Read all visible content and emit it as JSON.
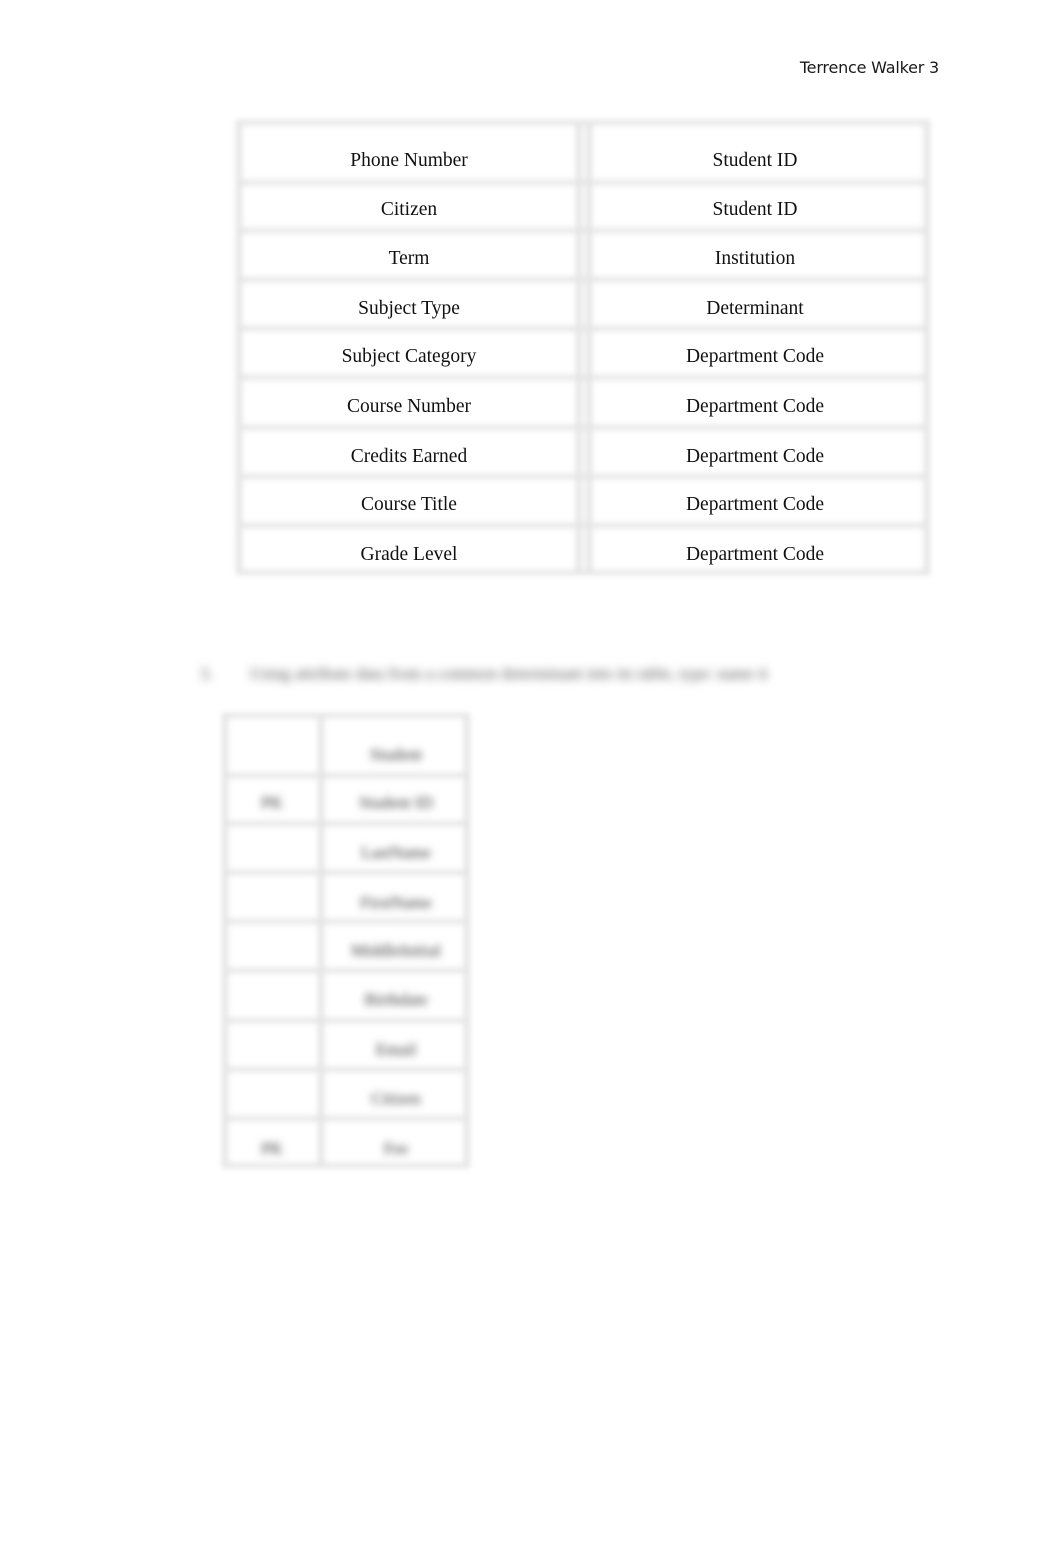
{
  "header": {
    "running_head": "Terrence Walker 3"
  },
  "table1": {
    "rows": [
      {
        "attribute": "Phone Number",
        "determinant": "Student ID"
      },
      {
        "attribute": "Citizen",
        "determinant": "Student ID"
      },
      {
        "attribute": "Term",
        "determinant": "Institution"
      },
      {
        "attribute": "Subject Type",
        "determinant": "Determinant"
      },
      {
        "attribute": "Subject Category",
        "determinant": "Department Code"
      },
      {
        "attribute": "Course Number",
        "determinant": "Department Code"
      },
      {
        "attribute": "Credits Earned",
        "determinant": "Department Code"
      },
      {
        "attribute": "Course Title",
        "determinant": "Department Code"
      },
      {
        "attribute": "Grade Level",
        "determinant": "Department Code"
      }
    ]
  },
  "blurred_section": {
    "question_number": "3.",
    "question_text": "Using attribute data from a common determinant into its table, type: name it",
    "table2": {
      "rows": [
        {
          "key": "",
          "field": "Student"
        },
        {
          "key": "PK",
          "field": "Student ID"
        },
        {
          "key": "",
          "field": "LastName"
        },
        {
          "key": "",
          "field": "FirstName"
        },
        {
          "key": "",
          "field": "MiddleInitial"
        },
        {
          "key": "",
          "field": "Birthdate"
        },
        {
          "key": "",
          "field": "Email"
        },
        {
          "key": "",
          "field": "Citizen"
        },
        {
          "key": "PK",
          "field": "Fee"
        }
      ]
    }
  }
}
